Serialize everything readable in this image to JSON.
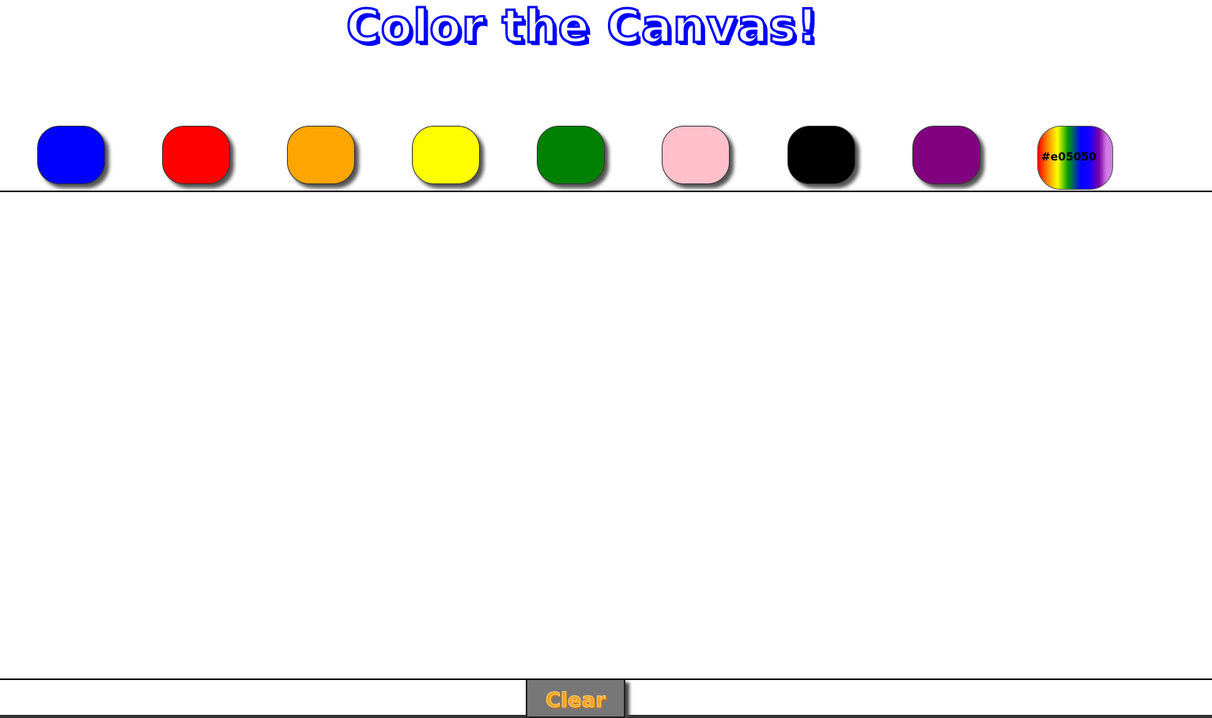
{
  "header": {
    "title": "Color the Canvas!"
  },
  "palette": {
    "swatches": [
      {
        "name": "blue",
        "color": "#0000ff"
      },
      {
        "name": "red",
        "color": "#ff0000"
      },
      {
        "name": "orange",
        "color": "#ffa500"
      },
      {
        "name": "yellow",
        "color": "#ffff00"
      },
      {
        "name": "green",
        "color": "#008000"
      },
      {
        "name": "pink",
        "color": "#ffc0cb"
      },
      {
        "name": "black",
        "color": "#000000"
      },
      {
        "name": "purple",
        "color": "#800080"
      }
    ],
    "custom_color": {
      "value": "#e05050"
    }
  },
  "canvas": {
    "background": "#ffffff"
  },
  "footer": {
    "clear_label": "Clear"
  },
  "colors": {
    "title_accent": "#0000ff",
    "clear_text": "#f7a21b",
    "clear_background": "#777777"
  }
}
